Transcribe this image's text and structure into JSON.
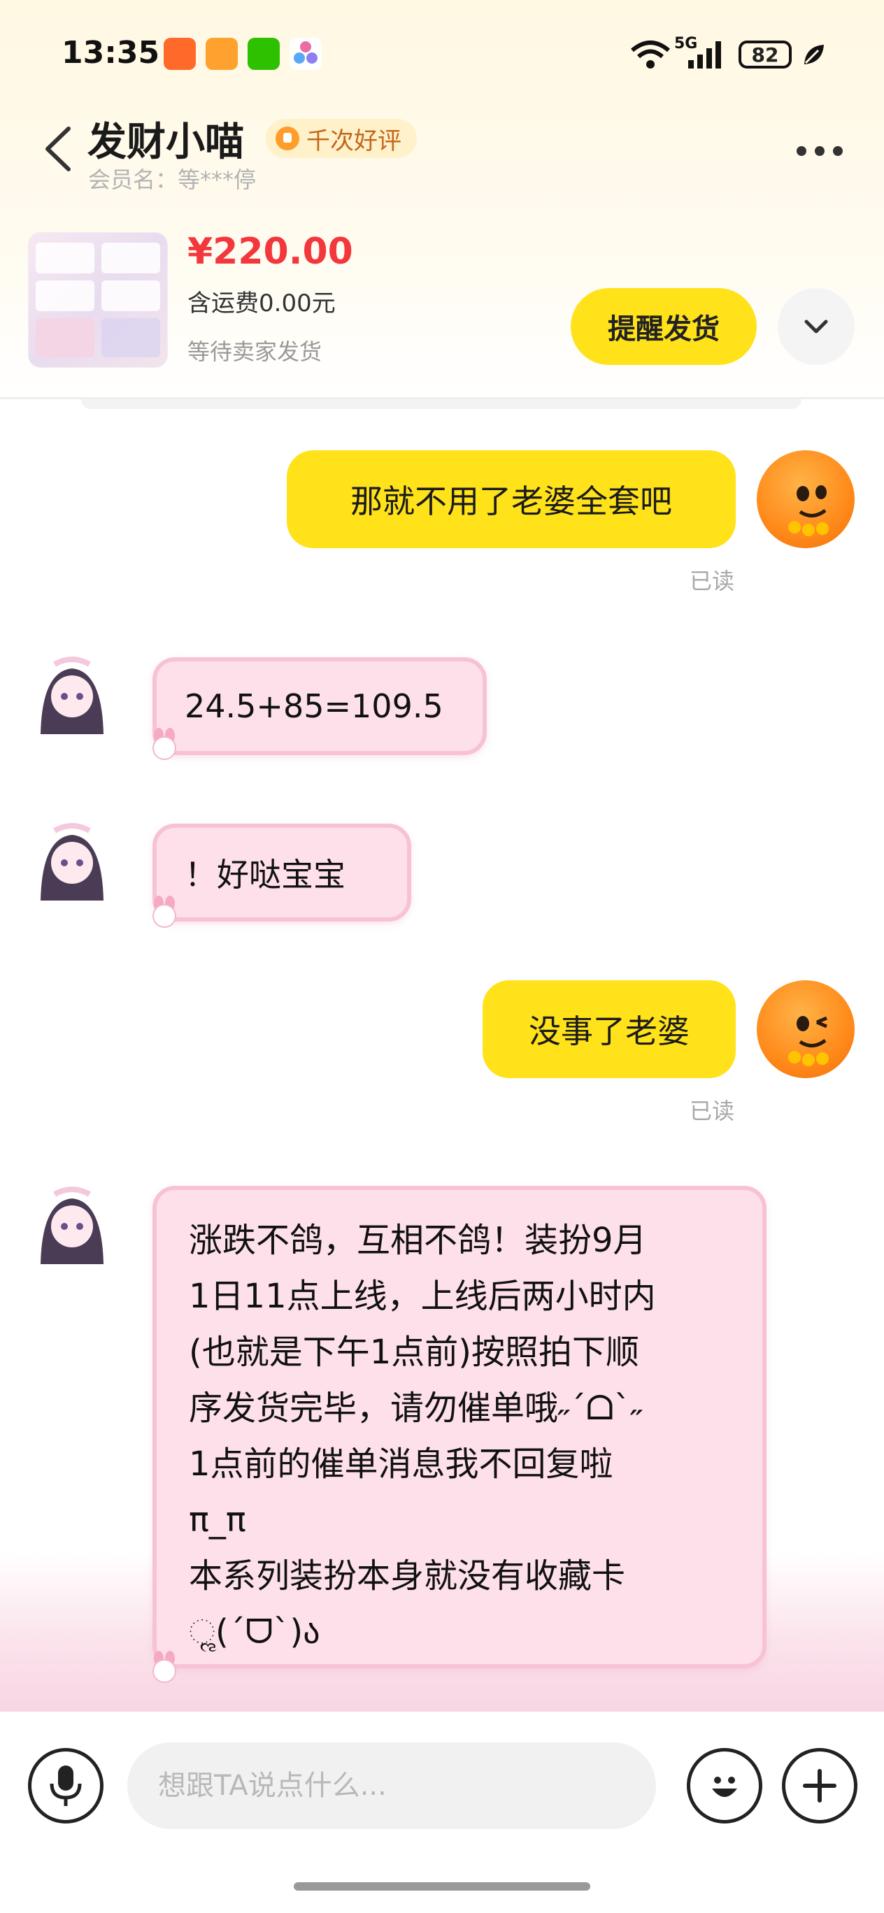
{
  "status_bar": {
    "time": "13:35",
    "network": "5G",
    "battery": "82"
  },
  "header": {
    "seller_name": "发财小喵",
    "badge": "千次好评",
    "member_label": "会员名：等***停"
  },
  "order": {
    "price": "¥220.00",
    "shipping": "含运费0.00元",
    "status": "等待卖家发货",
    "remind_button": "提醒发货"
  },
  "messages": [
    {
      "side": "me",
      "text": "那就不用了老婆全套吧",
      "read": "已读"
    },
    {
      "side": "seller",
      "text": "24.5+85=109.5"
    },
    {
      "side": "seller",
      "text": "！好哒宝宝"
    },
    {
      "side": "me",
      "text": "没事了老婆",
      "read": "已读"
    },
    {
      "side": "seller",
      "text": "涨跌不鸽，互相不鸽！装扮9月\n1日11点上线，上线后两小时内\n(也就是下午1点前)按照拍下顺\n序发货完毕，请勿催单哦˶´ᗝ`˶\n1点前的催单消息我不回复啦\nπ_π\n本系列装扮本身就没有收藏卡\nૢ(´ᗜ`)ა"
    }
  ],
  "input": {
    "placeholder": "想跟TA说点什么..."
  },
  "colors": {
    "accent_yellow": "#ffe21a",
    "price_red": "#f2383c",
    "bubble_pink": "#fde0ea"
  }
}
